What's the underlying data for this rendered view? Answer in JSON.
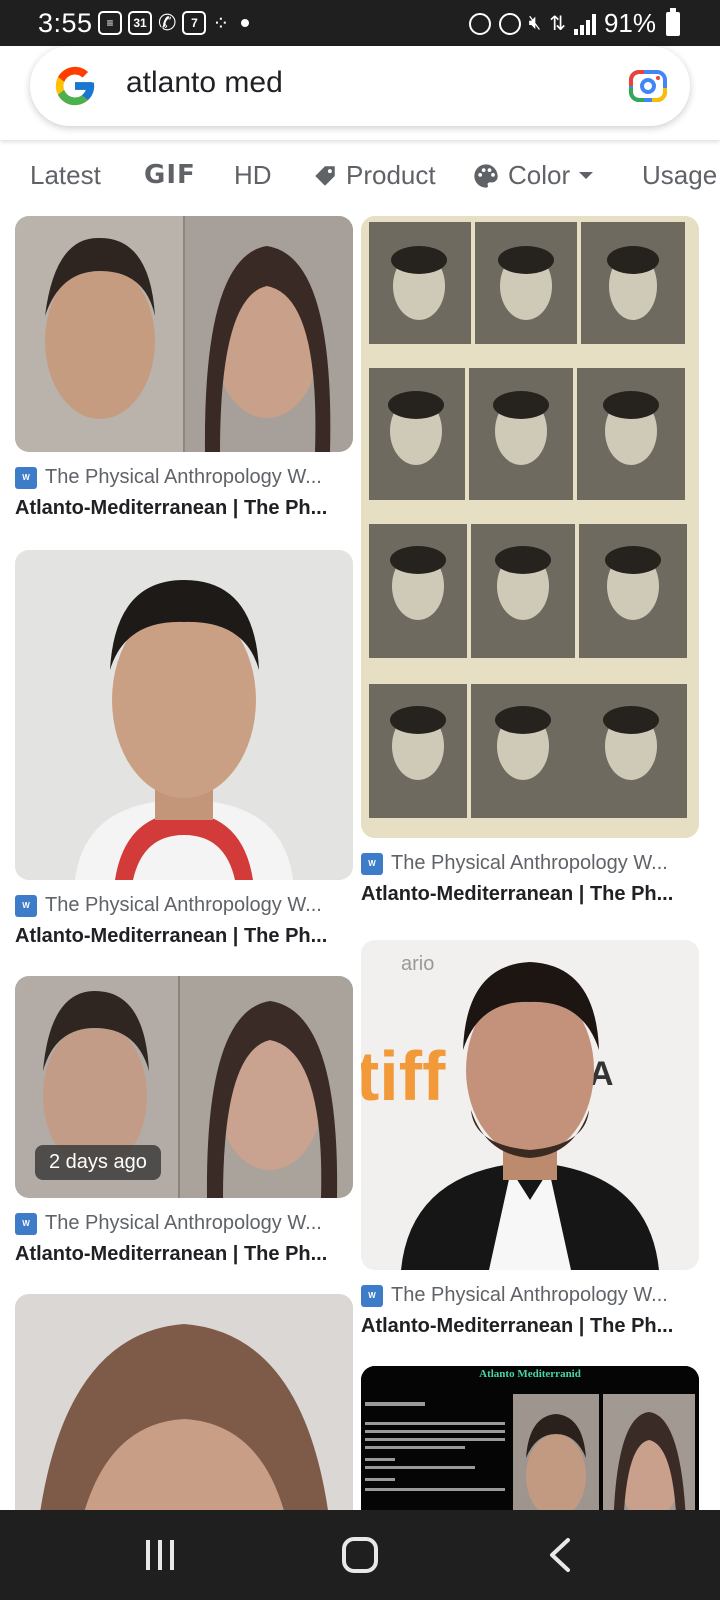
{
  "status_bar": {
    "time": "3:55",
    "battery": "91%",
    "calendar_badge": "31",
    "day_badge": "7"
  },
  "search": {
    "query": "atlanto med",
    "icons": [
      "google-logo",
      "google-lens-icon"
    ]
  },
  "filters": {
    "chips": [
      {
        "label": "Latest"
      },
      {
        "label": "GIF"
      },
      {
        "label": "HD"
      },
      {
        "label": "Product",
        "icon": "tag-icon"
      },
      {
        "label": "Color",
        "icon": "palette-icon",
        "dropdown": true
      },
      {
        "label": "Usage"
      }
    ]
  },
  "results": {
    "items": [
      {
        "source": "The Physical Anthropology W...",
        "title": "Atlanto-Mediterranean | The Ph...",
        "image": "composite male and female faces"
      },
      {
        "source": "The Physical Anthropology W...",
        "title": "Atlanto-Mediterranean | The Ph...",
        "image": "grid of vintage portrait photographs"
      },
      {
        "source": "The Physical Anthropology W...",
        "title": "Atlanto-Mediterranean | The Ph...",
        "image": "portrait of man in white shirt"
      },
      {
        "source": "The Physical Anthropology W...",
        "title": "Atlanto-Mediterranean | The Ph...",
        "image": "composite male and female faces",
        "badge": "2 days ago"
      },
      {
        "source": "The Physical Anthropology W...",
        "title": "Atlanto-Mediterranean | The Ph...",
        "image": "man in suit at film festival"
      },
      {
        "image": "close-up composite face"
      },
      {
        "image": "Atlanto Mediterranid infographic",
        "image_title": "Atlanto Mediterranid"
      }
    ]
  },
  "colors": {
    "status_bar": "#1f1f1f",
    "wiki_icon": "#3d7cc9",
    "text_secondary": "#5f6368"
  }
}
